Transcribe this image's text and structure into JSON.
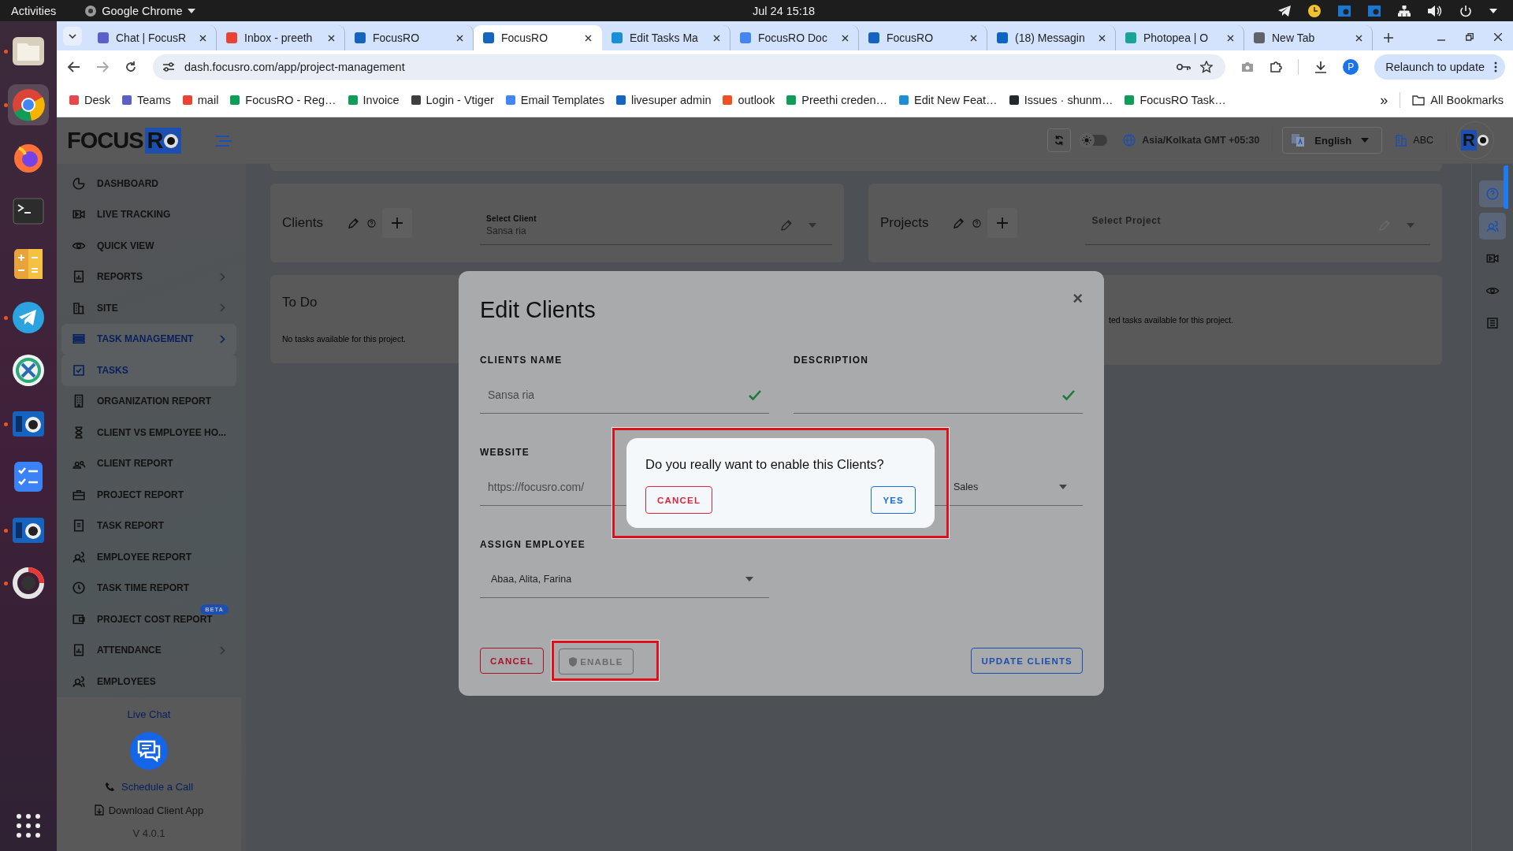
{
  "system_bar": {
    "activities": "Activities",
    "app_menu": "Google Chrome",
    "clock": "Jul 24  15:18"
  },
  "dock": [
    {
      "kind": "files",
      "running": true,
      "selected": false
    },
    {
      "kind": "chrome",
      "running": true,
      "selected": true
    },
    {
      "kind": "firefox",
      "running": false,
      "selected": false
    },
    {
      "kind": "terminal",
      "running": false,
      "selected": false
    },
    {
      "kind": "calculator",
      "running": false,
      "selected": false
    },
    {
      "kind": "telegram",
      "running": true,
      "selected": false
    },
    {
      "kind": "crossover",
      "running": false,
      "selected": false
    },
    {
      "kind": "focusro",
      "running": true,
      "selected": false
    },
    {
      "kind": "tasks",
      "running": false,
      "selected": false
    },
    {
      "kind": "focusro",
      "running": true,
      "selected": false
    },
    {
      "kind": "dial",
      "running": true,
      "selected": false
    },
    {
      "kind": "apps",
      "running": false,
      "selected": false
    }
  ],
  "browser": {
    "tabs": [
      {
        "title": "Chat | FocusR",
        "selected": false,
        "color": "#5b5fc7"
      },
      {
        "title": "Inbox - preeth",
        "selected": false,
        "color": "#ea4335"
      },
      {
        "title": "FocusRO",
        "selected": false,
        "color": "#1565c0"
      },
      {
        "title": "FocusRO",
        "selected": true,
        "color": "#1565c0"
      },
      {
        "title": "Edit Tasks Ma",
        "selected": false,
        "color": "#1a8fd6"
      },
      {
        "title": "FocusRO Doc",
        "selected": false,
        "color": "#4285f4"
      },
      {
        "title": "FocusRO",
        "selected": false,
        "color": "#1565c0"
      },
      {
        "title": "(18) Messagin",
        "selected": false,
        "color": "#0a66c2"
      },
      {
        "title": "Photopea | O",
        "selected": false,
        "color": "#18a497"
      },
      {
        "title": "New Tab",
        "selected": false,
        "color": "#5f6368"
      }
    ],
    "address": "dash.focusro.com/app/project-management",
    "relaunch": "Relaunch to update",
    "profile": "P",
    "bookmarks": [
      {
        "label": "Desk",
        "color": "#e5484d"
      },
      {
        "label": "Teams",
        "color": "#5b5fc7"
      },
      {
        "label": "mail",
        "color": "#ea4335"
      },
      {
        "label": "FocusRO - Reg…",
        "color": "#0f9d58"
      },
      {
        "label": "Invoice",
        "color": "#0f9d58"
      },
      {
        "label": "Login - Vtiger",
        "color": "#3c4043"
      },
      {
        "label": "Email Templates",
        "color": "#4285f4"
      },
      {
        "label": "livesuper admin",
        "color": "#1565c0"
      },
      {
        "label": "outlook",
        "color": "#f25022"
      },
      {
        "label": "Preethi creden…",
        "color": "#0f9d58"
      },
      {
        "label": "Edit New Feat…",
        "color": "#1a8fd6"
      },
      {
        "label": "Issues · shunm…",
        "color": "#24292f"
      },
      {
        "label": "FocusRO Task…",
        "color": "#0f9d58"
      }
    ],
    "more_bookmarks": "»",
    "all_bookmarks": "All Bookmarks"
  },
  "app": {
    "logo": {
      "text": "FOCUS",
      "mark": "R"
    },
    "sidebar": {
      "items": [
        {
          "label": "DASHBOARD",
          "selected": false,
          "expandable": false
        },
        {
          "label": "LIVE TRACKING",
          "selected": false,
          "expandable": false
        },
        {
          "label": "QUICK VIEW",
          "selected": false,
          "expandable": false
        },
        {
          "label": "REPORTS",
          "selected": false,
          "expandable": true
        },
        {
          "label": "SITE",
          "selected": false,
          "expandable": true
        },
        {
          "label": "TASK MANAGEMENT",
          "selected": true,
          "expandable": true
        },
        {
          "label": "TASKS",
          "selected": true,
          "expandable": false
        },
        {
          "label": "ORGANIZATION REPORT",
          "selected": false,
          "expandable": false
        },
        {
          "label": "CLIENT VS EMPLOYEE HO...",
          "selected": false,
          "expandable": false
        },
        {
          "label": "CLIENT REPORT",
          "selected": false,
          "expandable": false
        },
        {
          "label": "PROJECT REPORT",
          "selected": false,
          "expandable": false
        },
        {
          "label": "TASK REPORT",
          "selected": false,
          "expandable": false
        },
        {
          "label": "EMPLOYEE REPORT",
          "selected": false,
          "expandable": false
        },
        {
          "label": "TASK TIME REPORT",
          "selected": false,
          "expandable": false
        },
        {
          "label": "PROJECT COST REPORT",
          "selected": false,
          "expandable": false,
          "badge": "BETA"
        },
        {
          "label": "ATTENDANCE",
          "selected": false,
          "expandable": true
        },
        {
          "label": "EMPLOYEES",
          "selected": false,
          "expandable": false
        }
      ],
      "live_chat": "Live Chat",
      "schedule_call": "Schedule a Call",
      "download_app": "Download Client App",
      "version": "V 4.0.1"
    },
    "header": {
      "dark_mode": false,
      "timezone": "Asia/Kolkata GMT +05:30",
      "language": "English",
      "organization": "ABC",
      "avatar_mark": "R"
    },
    "clients_card": {
      "title": "Clients",
      "select_label": "Select Client",
      "select_value": "Sansa ria"
    },
    "projects_card": {
      "title": "Projects",
      "select_placeholder": "Select Project"
    },
    "todo_card": {
      "title": "To Do",
      "empty_text": "No tasks available for this project."
    },
    "completed_card": {
      "empty_text": "ted tasks available for this project."
    },
    "right_rail": [
      {
        "selected": true
      },
      {
        "selected": true
      },
      {
        "selected": false
      },
      {
        "selected": false
      },
      {
        "selected": false
      }
    ]
  },
  "dialog": {
    "title": "Edit Clients",
    "close": "×",
    "fields": [
      {
        "kind": "text",
        "label": "CLIENTS NAME",
        "value": "Sansa ria",
        "valid": true
      },
      {
        "kind": "text",
        "label": "DESCRIPTION",
        "valid": true
      },
      {
        "kind": "text",
        "label": "WEBSITE",
        "value": "https://focusro.com/"
      },
      {
        "kind": "select",
        "value": "Sales"
      },
      {
        "kind": "select",
        "label": "ASSIGN EMPLOYEE",
        "value": "Abaa, Alita, Farina"
      }
    ],
    "buttons": [
      {
        "kind": "danger",
        "label": "CANCEL",
        "disabled": false,
        "highlighted": false
      },
      {
        "kind": "neutral",
        "label": "ENABLE",
        "disabled": true,
        "highlighted": true
      },
      {
        "kind": "primary",
        "label": "UPDATE CLIENTS",
        "disabled": false,
        "highlighted": false
      }
    ]
  },
  "confirm": {
    "message": "Do you really want to enable this Clients?",
    "cancel": "CANCEL",
    "confirm": "YES",
    "highlighted": true
  }
}
